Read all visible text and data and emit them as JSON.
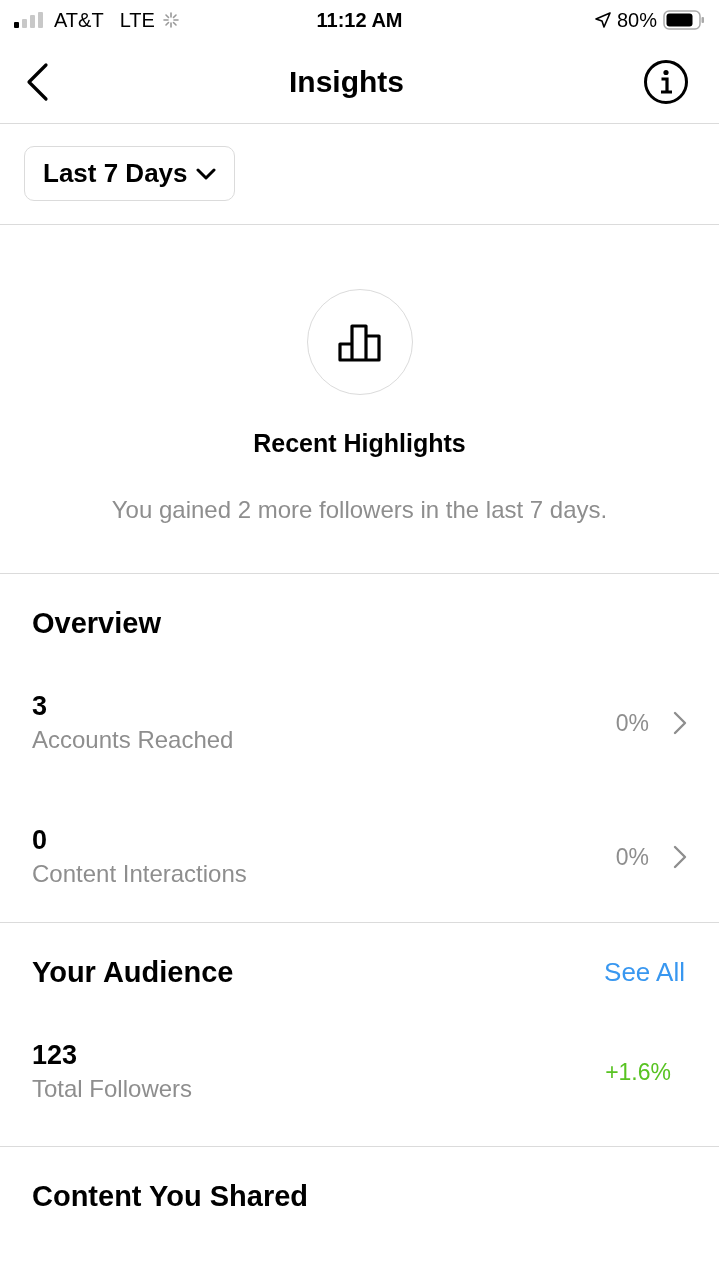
{
  "status_bar": {
    "carrier": "AT&T",
    "network": "LTE",
    "time": "11:12 AM",
    "battery": "80%"
  },
  "header": {
    "title": "Insights"
  },
  "date_filter": {
    "label": "Last 7 Days"
  },
  "highlights": {
    "title": "Recent Highlights",
    "text": "You gained 2 more followers in the last 7 days."
  },
  "overview": {
    "title": "Overview",
    "metrics": [
      {
        "value": "3",
        "label": "Accounts Reached",
        "change": "0%"
      },
      {
        "value": "0",
        "label": "Content Interactions",
        "change": "0%"
      }
    ]
  },
  "audience": {
    "title": "Your Audience",
    "link": "See All",
    "metrics": [
      {
        "value": "123",
        "label": "Total Followers",
        "change": "+1.6%"
      }
    ]
  },
  "content_shared": {
    "title": "Content You Shared"
  }
}
